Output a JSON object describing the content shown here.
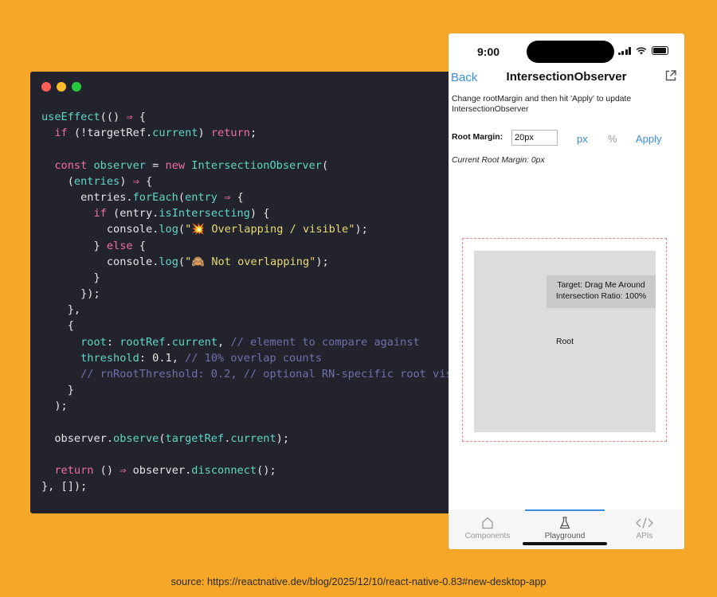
{
  "code": {
    "lines": [
      [
        [
          "useEffect",
          "f"
        ],
        [
          "(() ",
          "p"
        ],
        [
          "⇒",
          "ar"
        ],
        [
          " {",
          "p"
        ]
      ],
      [
        [
          "  ",
          "p"
        ],
        [
          "if",
          "k"
        ],
        [
          " (!",
          "p"
        ],
        [
          "targetRef",
          "v"
        ],
        [
          ".",
          "p"
        ],
        [
          "current",
          "f"
        ],
        [
          ") ",
          "p"
        ],
        [
          "return",
          "k"
        ],
        [
          ";",
          "p"
        ]
      ],
      [
        [
          "",
          "p"
        ]
      ],
      [
        [
          "  ",
          "p"
        ],
        [
          "const",
          "k"
        ],
        [
          " ",
          "p"
        ],
        [
          "observer",
          "f"
        ],
        [
          " = ",
          "p"
        ],
        [
          "new",
          "k"
        ],
        [
          " ",
          "p"
        ],
        [
          "IntersectionObserver",
          "f"
        ],
        [
          "(",
          "p"
        ]
      ],
      [
        [
          "    (",
          "p"
        ],
        [
          "entries",
          "f"
        ],
        [
          ") ",
          "p"
        ],
        [
          "⇒",
          "ar"
        ],
        [
          " {",
          "p"
        ]
      ],
      [
        [
          "      entries.",
          "p"
        ],
        [
          "forEach",
          "f"
        ],
        [
          "(",
          "p"
        ],
        [
          "entry",
          "f"
        ],
        [
          " ",
          "p"
        ],
        [
          "⇒",
          "ar"
        ],
        [
          " {",
          "p"
        ]
      ],
      [
        [
          "        ",
          "p"
        ],
        [
          "if",
          "k"
        ],
        [
          " (entry.",
          "p"
        ],
        [
          "isIntersecting",
          "f"
        ],
        [
          ") {",
          "p"
        ]
      ],
      [
        [
          "          console.",
          "p"
        ],
        [
          "log",
          "f"
        ],
        [
          "(",
          "p"
        ],
        [
          "\"💥 Overlapping / visible\"",
          "s"
        ],
        [
          ");",
          "p"
        ]
      ],
      [
        [
          "        } ",
          "p"
        ],
        [
          "else",
          "k"
        ],
        [
          " {",
          "p"
        ]
      ],
      [
        [
          "          console.",
          "p"
        ],
        [
          "log",
          "f"
        ],
        [
          "(",
          "p"
        ],
        [
          "\"🙈 Not overlapping\"",
          "s"
        ],
        [
          ");",
          "p"
        ]
      ],
      [
        [
          "        }",
          "p"
        ]
      ],
      [
        [
          "      });",
          "p"
        ]
      ],
      [
        [
          "    },",
          "p"
        ]
      ],
      [
        [
          "    {",
          "p"
        ]
      ],
      [
        [
          "      ",
          "p"
        ],
        [
          "root",
          "f"
        ],
        [
          ": ",
          "p"
        ],
        [
          "rootRef",
          "f"
        ],
        [
          ".",
          "p"
        ],
        [
          "current",
          "f"
        ],
        [
          ", ",
          "p"
        ],
        [
          "// element to compare against",
          "c"
        ]
      ],
      [
        [
          "      ",
          "p"
        ],
        [
          "threshold",
          "f"
        ],
        [
          ": 0.1, ",
          "p"
        ],
        [
          "// 10% overlap counts",
          "c"
        ]
      ],
      [
        [
          "      ",
          "p"
        ],
        [
          "// rnRootThreshold: 0.2, // optional RN-specific root vis",
          "c"
        ]
      ],
      [
        [
          "    }",
          "p"
        ]
      ],
      [
        [
          "  );",
          "p"
        ]
      ],
      [
        [
          "",
          "p"
        ]
      ],
      [
        [
          "  observer.",
          "p"
        ],
        [
          "observe",
          "f"
        ],
        [
          "(",
          "p"
        ],
        [
          "targetRef",
          "f"
        ],
        [
          ".",
          "p"
        ],
        [
          "current",
          "f"
        ],
        [
          ");",
          "p"
        ]
      ],
      [
        [
          "",
          "p"
        ]
      ],
      [
        [
          "  ",
          "p"
        ],
        [
          "return",
          "k"
        ],
        [
          " () ",
          "p"
        ],
        [
          "⇒",
          "ar"
        ],
        [
          " observer.",
          "p"
        ],
        [
          "disconnect",
          "f"
        ],
        [
          "();",
          "p"
        ]
      ],
      [
        [
          "}, []);",
          "p"
        ]
      ]
    ]
  },
  "phone": {
    "status_time": "9:00",
    "nav": {
      "back": "Back",
      "title": "IntersectionObserver"
    },
    "description": "Change rootMargin and then hit 'Apply' to update IntersectionObserver",
    "root_margin_label": "Root Margin:",
    "root_margin_value": "20px",
    "unit_px": "px",
    "unit_percent": "%",
    "apply": "Apply",
    "current_root_margin": "Current Root Margin: 0px",
    "root_label": "Root",
    "target_line1": "Target: Drag Me Around",
    "target_line2": "Intersection Ratio: 100%",
    "tabs": [
      {
        "label": "Components",
        "icon": "home-icon"
      },
      {
        "label": "Playground",
        "icon": "flask-icon"
      },
      {
        "label": "APIs",
        "icon": "code-icon"
      }
    ],
    "active_tab": "Playground"
  },
  "source": "source: https://reactnative.dev/blog/2025/12/10/react-native-0.83#new-desktop-app",
  "colors": {
    "background": "#F6A727",
    "code_bg": "#23232E",
    "keyword": "#EE6FA0",
    "function": "#5FD7C5",
    "string": "#E6DB74",
    "comment": "#6F72A8",
    "ios_blue": "#3B8DE0",
    "dashed": "#E8887E"
  }
}
